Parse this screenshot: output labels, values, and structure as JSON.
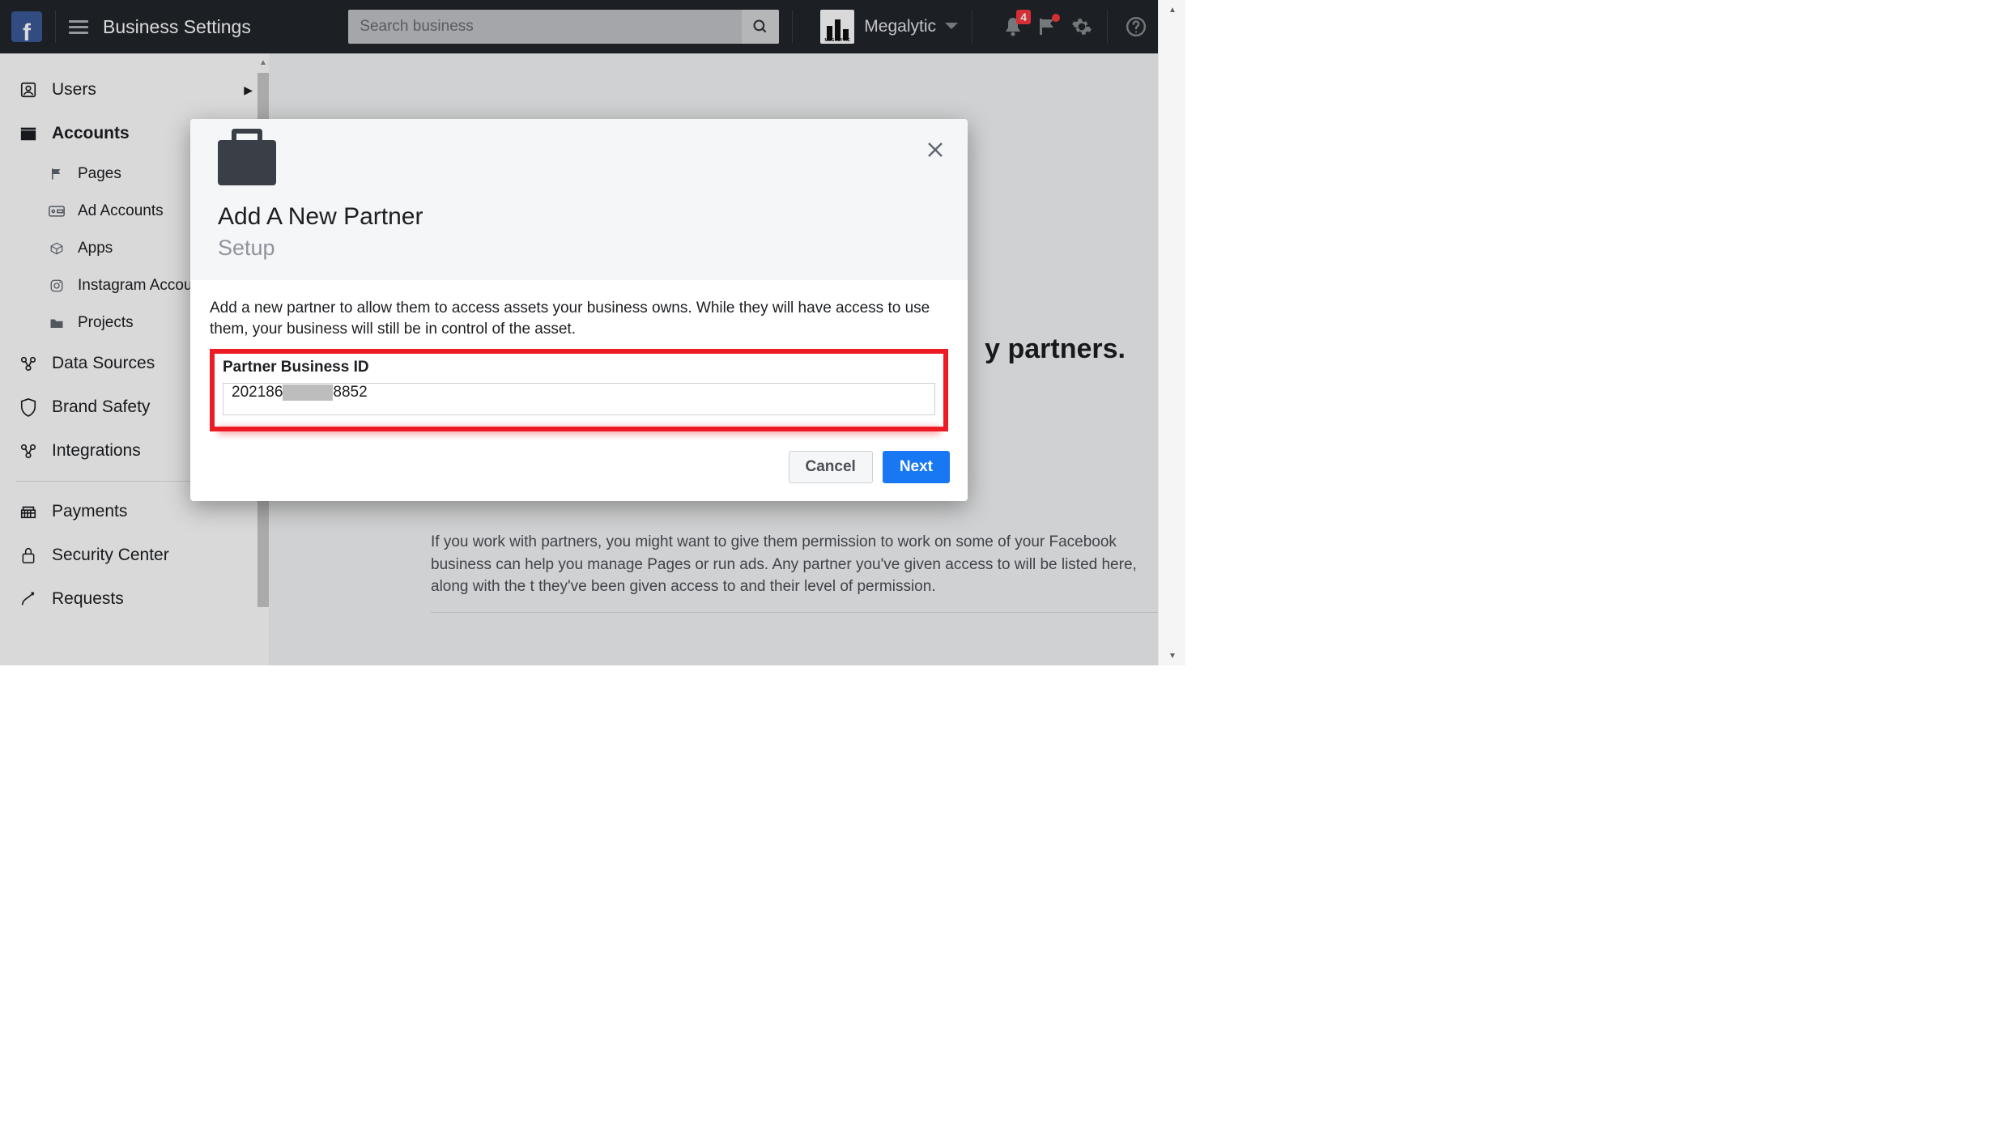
{
  "topbar": {
    "page_title": "Business Settings",
    "search_placeholder": "Search business",
    "business_name": "Megalytic",
    "notification_count": "4"
  },
  "sidebar": {
    "items": [
      {
        "label": "Users",
        "has_caret": true
      },
      {
        "label": "Accounts",
        "bold": true,
        "expanded": true,
        "children": [
          {
            "label": "Pages"
          },
          {
            "label": "Ad Accounts"
          },
          {
            "label": "Apps"
          },
          {
            "label": "Instagram Accounts"
          },
          {
            "label": "Projects"
          }
        ]
      },
      {
        "label": "Data Sources"
      },
      {
        "label": "Brand Safety"
      },
      {
        "label": "Integrations"
      },
      {
        "label": "Payments"
      },
      {
        "label": "Security Center"
      },
      {
        "label": "Requests"
      }
    ]
  },
  "main": {
    "heading_fragment": "y partners.",
    "description": "If you work with partners, you might want to give them permission to work on some of your Facebook business can help you manage Pages or run ads. Any partner you've given access to will be listed here, along with the t they've been given access to and their level of permission."
  },
  "modal": {
    "title": "Add A New Partner",
    "subtitle": "Setup",
    "description": "Add a new partner to allow them to access assets your business owns. While they will have access to use them, your business will still be in control of the asset.",
    "field_label": "Partner Business ID",
    "field_value_prefix": "202186",
    "field_value_suffix": "8852",
    "cancel_label": "Cancel",
    "next_label": "Next"
  }
}
